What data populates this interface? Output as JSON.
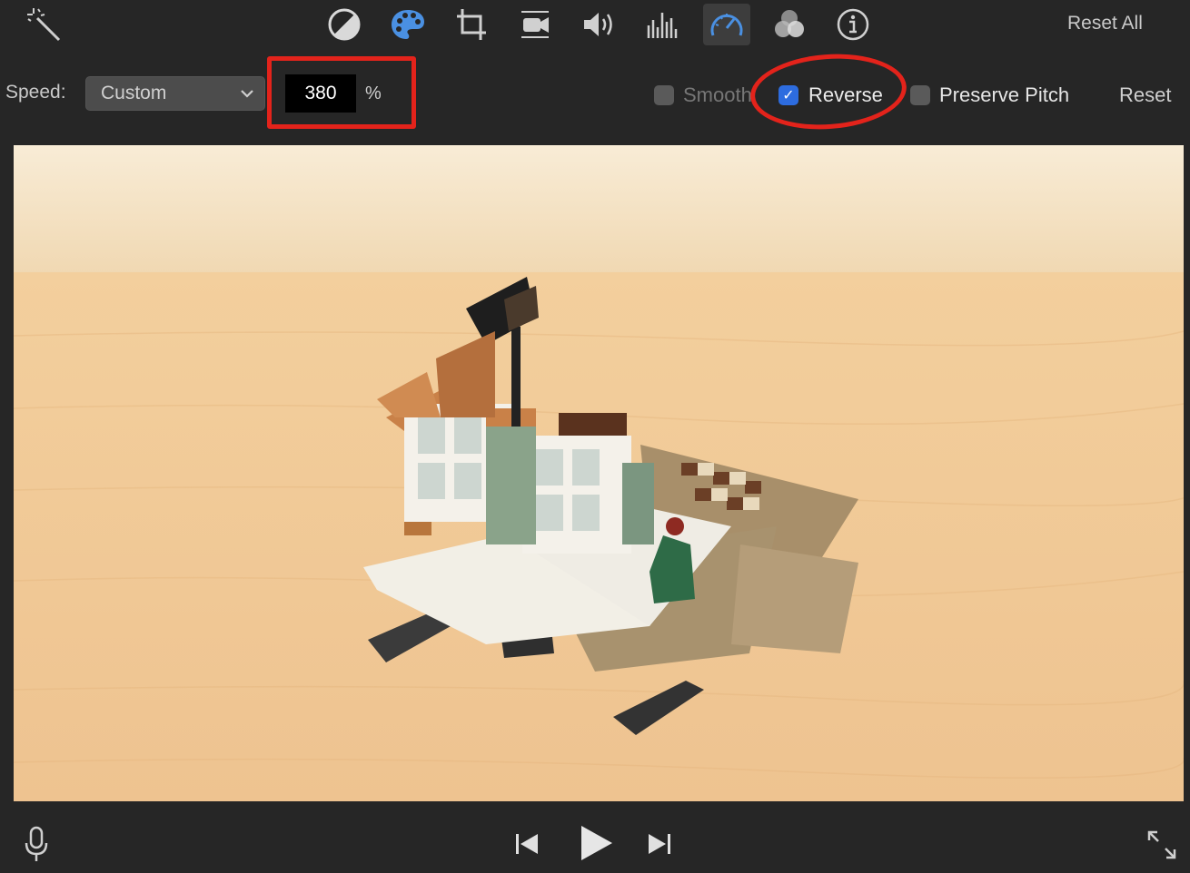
{
  "toolbar": {
    "icons": [
      "magic-wand-icon",
      "color-balance-icon",
      "color-palette-icon",
      "crop-icon",
      "stabilization-icon",
      "volume-icon",
      "equalizer-icon",
      "speed-icon",
      "filter-icon",
      "info-icon"
    ],
    "reset_all_label": "Reset All",
    "accent": "#4a90e2"
  },
  "speed": {
    "label": "Speed:",
    "mode_value": "Custom",
    "percent_value": "380",
    "percent_unit": "%",
    "smooth_label": "Smooth",
    "smooth_checked": false,
    "reverse_label": "Reverse",
    "reverse_checked": true,
    "preserve_pitch_label": "Preserve Pitch",
    "preserve_pitch_checked": false,
    "reset_label": "Reset"
  },
  "annotations": {
    "highlight_color": "#e3231b"
  },
  "viewer": {
    "content": "video-frame"
  },
  "playback": {
    "icons": [
      "microphone-icon",
      "skip-back-icon",
      "play-icon",
      "skip-forward-icon",
      "fullscreen-icon"
    ]
  }
}
